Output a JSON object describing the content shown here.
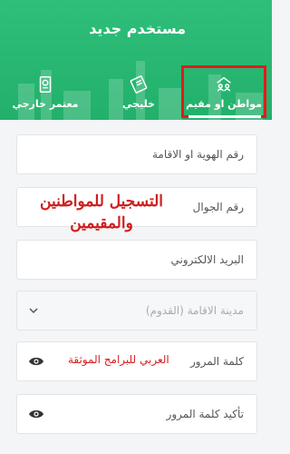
{
  "header": {
    "title": "مستخدم جديد"
  },
  "tabs": [
    {
      "label": "مواطن او مقيم",
      "icon": "people-building-icon",
      "selected": true
    },
    {
      "label": "خليجي",
      "icon": "card-icon",
      "selected": false
    },
    {
      "label": "معتمر خارجي",
      "icon": "passport-icon",
      "selected": false
    }
  ],
  "form": {
    "id_placeholder": "رقم الهوية او الاقامة",
    "mobile_placeholder": "رقم الجوال",
    "email_placeholder": "البريد الالكتروني",
    "city_placeholder": "مدينة الاقامة (القدوم)",
    "password_placeholder": "كلمة المرور",
    "confirm_placeholder": "تأكيد كلمة المرور"
  },
  "annotations": {
    "main": "التسجيل للمواطنين والمقيمين",
    "watermark": "العربي للبرامج الموثقة"
  },
  "colors": {
    "header": "#22b06b",
    "annotation": "#cf1f1f"
  }
}
